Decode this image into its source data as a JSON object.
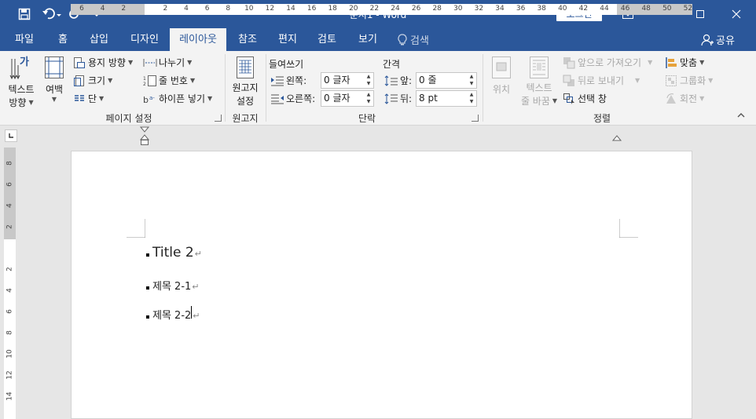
{
  "window": {
    "title": "문서1  -  Word",
    "login": "로그인"
  },
  "tabs": [
    "파일",
    "홈",
    "삽입",
    "디자인",
    "레이아웃",
    "참조",
    "편지",
    "검토",
    "보기"
  ],
  "active_tab": "레이아웃",
  "tell_me": "검색",
  "share": "공유",
  "ribbon": {
    "page_setup": {
      "text_direction": "텍스트\n방향",
      "text_direction_l1": "텍스트",
      "text_direction_l2": "방향",
      "margins": "여백",
      "orientation": "용지 방향",
      "size": "크기",
      "columns": "단",
      "breaks": "나누기",
      "line_numbers": "줄 번호",
      "hyphenation": "하이픈 넣기",
      "label": "페이지 설정"
    },
    "manuscript": {
      "btn_l1": "원고지",
      "btn_l2": "설정",
      "label": "원고지"
    },
    "paragraph": {
      "indent_title": "들여쓰기",
      "spacing_title": "간격",
      "left_label": "왼쪽:",
      "right_label": "오른쪽:",
      "before_label": "앞:",
      "after_label": "뒤:",
      "left_value": "0 글자",
      "right_value": "0 글자",
      "before_value": "0 줄",
      "after_value": "8 pt",
      "label": "단락"
    },
    "arrange": {
      "position": "위치",
      "wrap_l1": "텍스트",
      "wrap_l2": "줄 바꿈",
      "bring_forward": "앞으로 가져오기",
      "send_backward": "뒤로 보내기",
      "selection_pane": "선택 창",
      "align": "맞춤",
      "group": "그룹화",
      "rotate": "회전",
      "label": "정렬"
    }
  },
  "ruler": {
    "h_ticks": [
      "6",
      "4",
      "2",
      "",
      "2",
      "4",
      "6",
      "8",
      "10",
      "12",
      "14",
      "16",
      "18",
      "20",
      "22",
      "24",
      "26",
      "28",
      "30",
      "32",
      "34",
      "36",
      "38",
      "40",
      "42",
      "44",
      "46",
      "48",
      "50",
      "52"
    ],
    "v_ticks": [
      "8",
      "6",
      "4",
      "2",
      "",
      "2",
      "4",
      "6",
      "8",
      "10",
      "12",
      "14"
    ]
  },
  "document": {
    "paragraphs": [
      "Title 2",
      "제목  2-1",
      "제목  2-2"
    ]
  },
  "colors": {
    "brand": "#2b579a",
    "ribbon": "#f3f3f3",
    "canvas": "#e6e6e6"
  }
}
